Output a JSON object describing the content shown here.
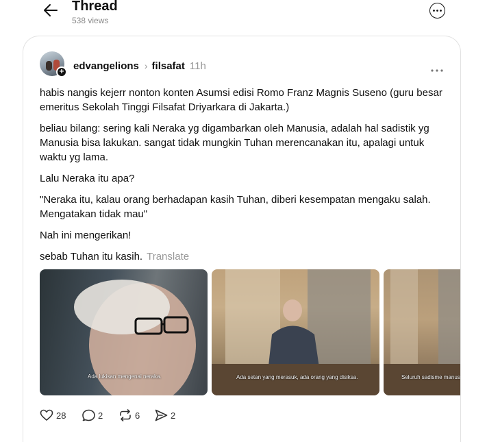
{
  "header": {
    "title": "Thread",
    "views": "538 views"
  },
  "post": {
    "username": "edvangelions",
    "topic": "filsafat",
    "time": "11h",
    "paragraphs": [
      "habis nangis kejerr nonton konten Asumsi edisi Romo Franz Magnis Suseno (guru besar emeritus Sekolah Tinggi Filsafat Driyarkara di Jakarta.)",
      "beliau bilang: sering kali Neraka yg digambarkan oleh Manusia, adalah hal sadistik yg Manusia bisa lakukan. sangat tidak mungkin Tuhan merencanakan itu, apalagi untuk waktu yg lama.",
      "Lalu Neraka itu apa?",
      "\"Neraka itu, kalau orang berhadapan kasih Tuhan, diberi kesempatan mengaku salah. Mengatakan tidak mau\"",
      "Nah ini mengerikan!"
    ],
    "last_line": "sebab Tuhan itu kasih.",
    "translate_label": "Translate",
    "media_captions": [
      "Ada lukisan mengenai neraka.",
      "Ada setan yang merasuk, ada orang yang disiksa.",
      "Seluruh sadisme manusia"
    ],
    "counts": {
      "likes": "28",
      "replies": "2",
      "reposts": "6",
      "shares": "2"
    }
  }
}
